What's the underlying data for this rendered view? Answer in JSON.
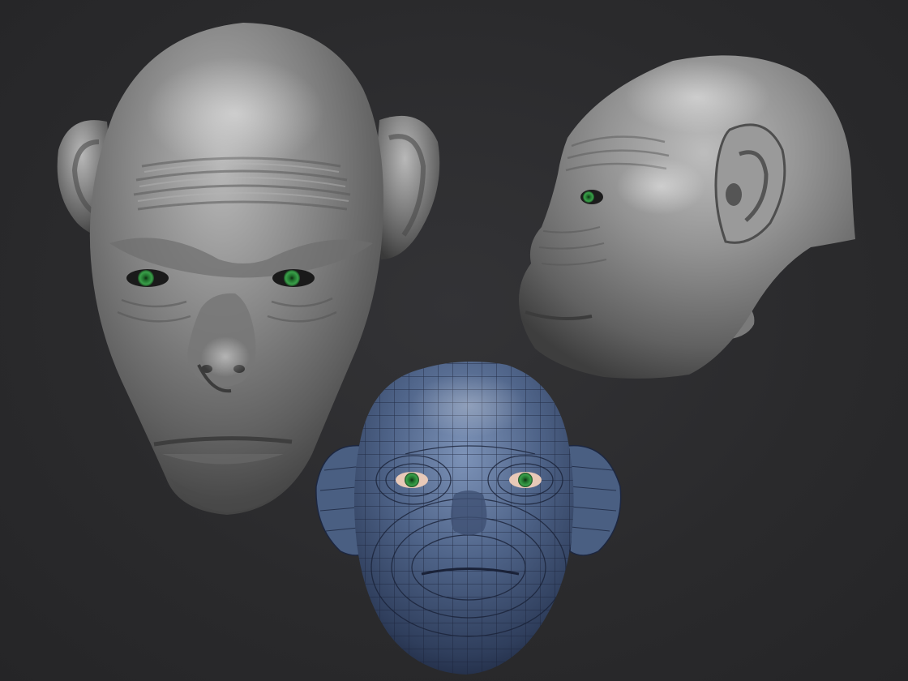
{
  "scene": {
    "background_color": "#2b2b2d",
    "views": [
      {
        "name": "front-sculpt",
        "material": "matcap-gray",
        "color": "#8a8a8a"
      },
      {
        "name": "side-sculpt",
        "material": "matcap-gray",
        "color": "#8c8c8c"
      },
      {
        "name": "front-wireframe",
        "material": "blue-topology",
        "color": "#4a5f82",
        "wire_color": "#1d2740"
      }
    ],
    "eye_color": "#2f8a3c"
  }
}
